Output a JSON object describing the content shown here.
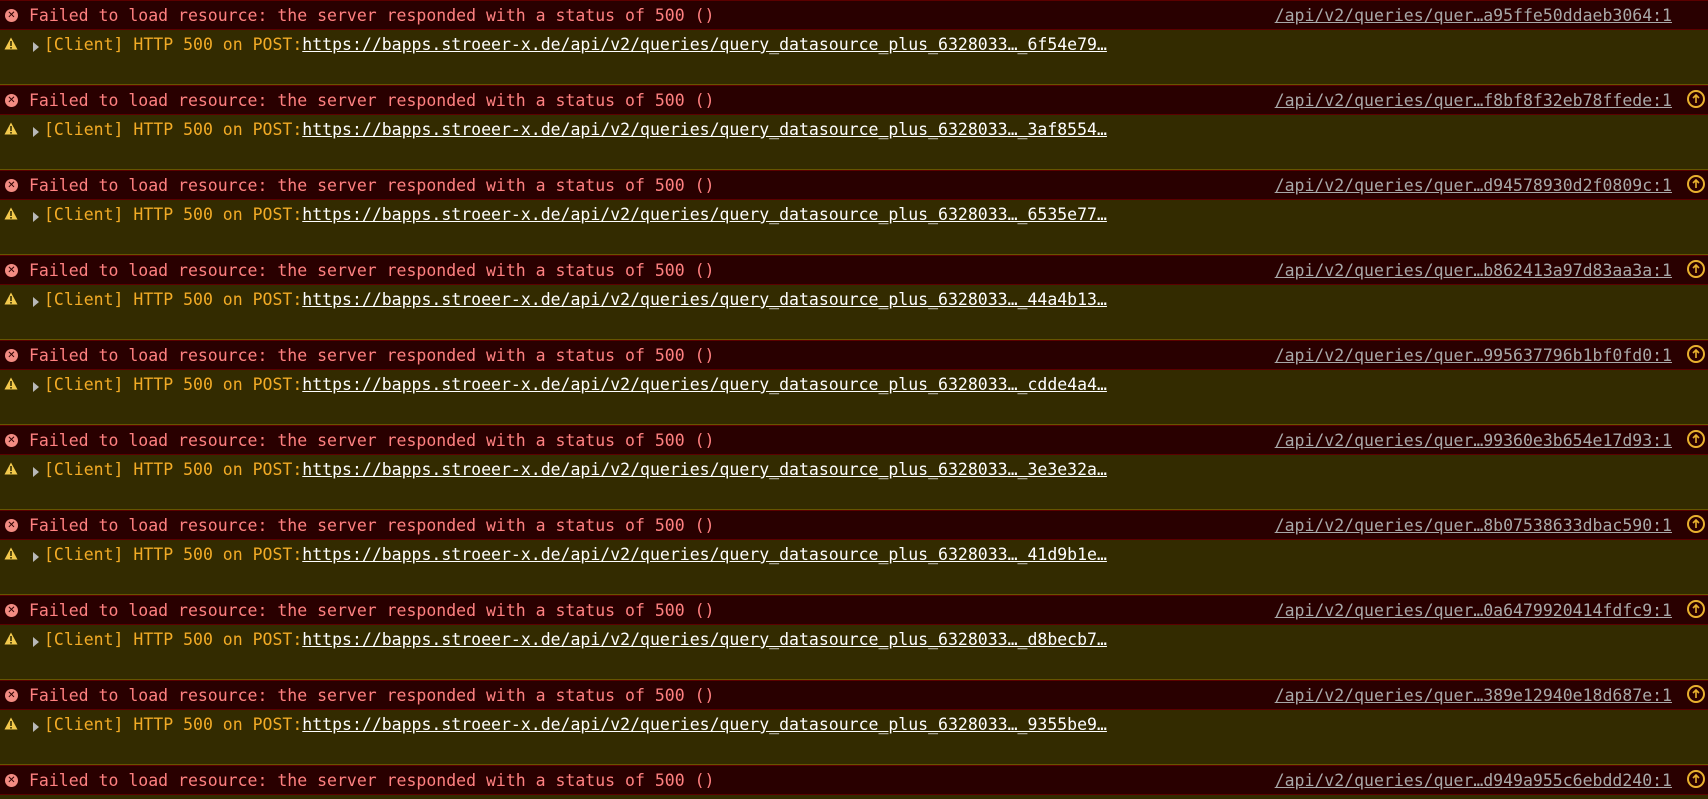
{
  "error_message": "Failed to load resource: the server responded with a status of 500 ()",
  "warning_prefix": "[Client] HTTP 500 on POST:",
  "colors": {
    "error_bg": "#290000",
    "error_text": "#ff8080",
    "warning_bg": "#332b00",
    "warning_text": "#f2ab26"
  },
  "icons": {
    "error": "error-circle-icon",
    "warning": "warning-triangle-icon",
    "expand": "expand-triangle-icon",
    "reload": "reload-circle-icon"
  },
  "entries": [
    {
      "error_source": "/api/v2/queries/quer…a95ffe50ddaeb3064:1",
      "has_reload": false,
      "warning_url": "https://bapps.stroeer-x.de/api/v2/queries/query_datasource_plus_6328033…_6f54e79…"
    },
    {
      "error_source": "/api/v2/queries/quer…f8bf8f32eb78ffede:1",
      "has_reload": true,
      "warning_url": "https://bapps.stroeer-x.de/api/v2/queries/query_datasource_plus_6328033…_3af8554…"
    },
    {
      "error_source": "/api/v2/queries/quer…d94578930d2f0809c:1",
      "has_reload": true,
      "warning_url": "https://bapps.stroeer-x.de/api/v2/queries/query_datasource_plus_6328033…_6535e77…"
    },
    {
      "error_source": "/api/v2/queries/quer…b862413a97d83aa3a:1",
      "has_reload": true,
      "warning_url": "https://bapps.stroeer-x.de/api/v2/queries/query_datasource_plus_6328033…_44a4b13…"
    },
    {
      "error_source": "/api/v2/queries/quer…995637796b1bf0fd0:1",
      "has_reload": true,
      "warning_url": "https://bapps.stroeer-x.de/api/v2/queries/query_datasource_plus_6328033…_cdde4a4…"
    },
    {
      "error_source": "/api/v2/queries/quer…99360e3b654e17d93:1",
      "has_reload": true,
      "warning_url": "https://bapps.stroeer-x.de/api/v2/queries/query_datasource_plus_6328033…_3e3e32a…"
    },
    {
      "error_source": "/api/v2/queries/quer…8b07538633dbac590:1",
      "has_reload": true,
      "warning_url": "https://bapps.stroeer-x.de/api/v2/queries/query_datasource_plus_6328033…_41d9b1e…"
    },
    {
      "error_source": "/api/v2/queries/quer…0a6479920414fdfc9:1",
      "has_reload": true,
      "warning_url": "https://bapps.stroeer-x.de/api/v2/queries/query_datasource_plus_6328033…_d8becb7…"
    },
    {
      "error_source": "/api/v2/queries/quer…389e12940e18d687e:1",
      "has_reload": true,
      "warning_url": "https://bapps.stroeer-x.de/api/v2/queries/query_datasource_plus_6328033…_9355be9…"
    },
    {
      "error_source": "/api/v2/queries/quer…d949a955c6ebdd240:1",
      "has_reload": true,
      "warning_url": null
    }
  ]
}
